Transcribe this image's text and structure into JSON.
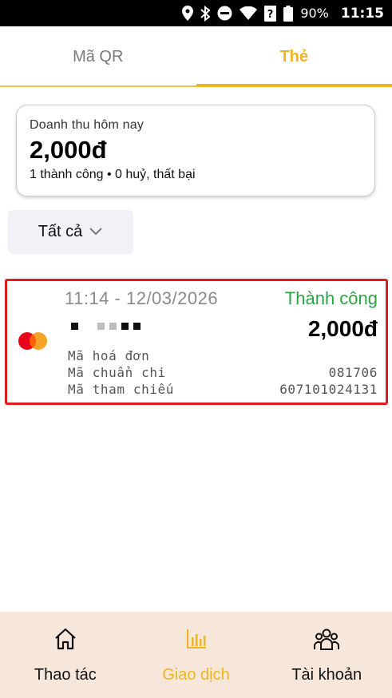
{
  "status_bar": {
    "battery": "90%",
    "time": "11:15"
  },
  "tabs": [
    {
      "label": "Mã QR",
      "active": false
    },
    {
      "label": "Thẻ",
      "active": true
    }
  ],
  "revenue": {
    "label": "Doanh thu hôm nay",
    "amount": "2,000đ",
    "summary": "1 thành công • 0 huỷ, thất bại"
  },
  "filter": {
    "label": "Tất cả"
  },
  "transaction": {
    "datetime": "11:14 - 12/03/2026",
    "status": "Thành công",
    "amount": "2,000đ",
    "rows": [
      {
        "label": "Mã hoá đơn",
        "value": ""
      },
      {
        "label": "Mã chuẩn chi",
        "value": "081706"
      },
      {
        "label": "Mã tham chiếu",
        "value": "607101024131"
      }
    ]
  },
  "bottom_nav": [
    {
      "label": "Thao tác",
      "icon": "home-icon",
      "active": false
    },
    {
      "label": "Giao dịch",
      "icon": "bar-chart-icon",
      "active": true
    },
    {
      "label": "Tài khoản",
      "icon": "users-icon",
      "active": false
    }
  ],
  "colors": {
    "accent": "#f0b423",
    "success": "#2aa545",
    "highlight_border": "#e01c1c",
    "nav_bg": "#f7e7da"
  }
}
